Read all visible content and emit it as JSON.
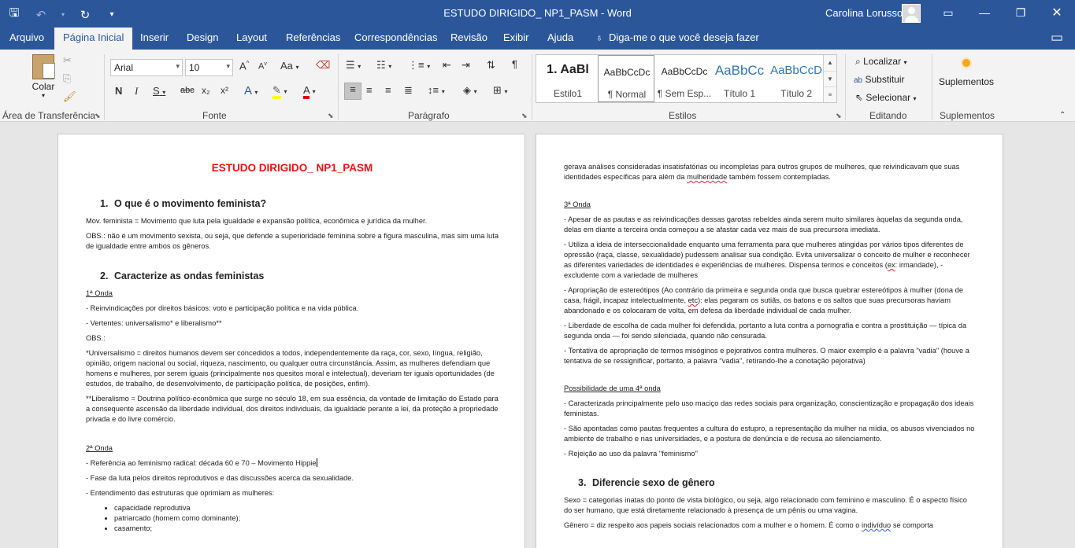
{
  "titlebar": {
    "window_title": "ESTUDO DIRIGIDO_ NP1_PASM  -  Word",
    "user_name": "Carolina Lorusso",
    "icons": {
      "save": "save-icon",
      "undo": "undo-icon",
      "redo": "redo-icon",
      "customize": "customize-qat-icon",
      "ribbon_display": "ribbon-display-options-icon",
      "minimize": "minimize-icon",
      "restore": "restore-icon",
      "close": "close-icon"
    }
  },
  "tabs": [
    "Arquivo",
    "Página Inicial",
    "Inserir",
    "Design",
    "Layout",
    "Referências",
    "Correspondências",
    "Revisão",
    "Exibir",
    "Ajuda"
  ],
  "active_tab": "Página Inicial",
  "tell_me": "Diga-me o que você deseja fazer",
  "ribbon": {
    "clipboard": {
      "paste": "Colar",
      "label": "Área de Transferência"
    },
    "font": {
      "name": "Arial",
      "size": "10",
      "label": "Fonte",
      "buttons": {
        "grow": "A",
        "shrink": "A",
        "case": "Aa",
        "bold": "N",
        "italic": "I",
        "underline": "S",
        "strike": "abc",
        "sub": "x₂",
        "sup": "x²",
        "effects": "A",
        "font_color": "A"
      }
    },
    "paragraph": {
      "label": "Parágrafo"
    },
    "styles": {
      "label": "Estilos",
      "items": [
        {
          "preview": "1. AaBl",
          "name": "Estilo1"
        },
        {
          "preview": "AaBbCcDc",
          "name": "¶ Normal"
        },
        {
          "preview": "AaBbCcDc",
          "name": "¶ Sem Esp..."
        },
        {
          "preview": "AaBbCc",
          "name": "Título 1"
        },
        {
          "preview": "AaBbCcD",
          "name": "Título 2"
        }
      ]
    },
    "editing": {
      "label": "Editando",
      "find": "Localizar",
      "replace": "Substituir",
      "select": "Selecionar"
    },
    "addins": {
      "button": "Suplementos",
      "label": "Suplementos"
    }
  },
  "colors": {
    "accent": "#2b579a",
    "doc_title": "#ee1111",
    "ribbon_bg": "#f3f3f3",
    "canvas": "#e6e6e6"
  },
  "page1": {
    "title": "ESTUDO DIRIGIDO_ NP1_PASM",
    "q1": {
      "num": "1.",
      "text": "O que é o movimento feminista?"
    },
    "p1": "Mov. feminista = Movimento que luta pela igualdade e expansão política, econômica e jurídica da mulher.",
    "p2": "OBS.: não é um movimento sexista, ou seja, que defende a superioridade feminina sobre a figura masculina, mas sim uma luta de igualdade entre ambos os gêneros.",
    "q2": {
      "num": "2.",
      "text": "Caracterize as ondas feministas"
    },
    "onda1": "1ª Onda",
    "p3": "- Reinvindicações por direitos básicos: voto e participação política e na vida pública.",
    "p4": "- Vertentes: universalismo* e liberalismo**",
    "p5": "OBS.:",
    "p6": "*Universalismo = direitos humanos devem ser concedidos a todos, independentemente da raça, cor, sexo, língua, religião, opinião, origem nacional ou social, riqueza, nascimento, ou qualquer outra circunstância. Assim, as mulheres defendiam que homens e mulheres, por serem iguais (principalmente nos quesitos moral e intelectual), deveriam ter iguais oportunidades (de estudos, de trabalho, de desenvolvimento, de participação política, de posições, enfim).",
    "p7": "**Liberalismo = Doutrina político-econômica que surge no século 18, em sua essência, da vontade de limitação do Estado para a consequente ascensão da liberdade individual, dos direitos individuais, da igualdade perante a lei, da proteção à propriedade privada e do livre comércio.",
    "onda2": "2ª Onda",
    "p8": "- Referência ao feminismo radical: década 60 e 70 – Movimento Hippie",
    "p9": "- Fase da luta pelos direitos reprodutivos e das discussões acerca da sexualidade.",
    "p10": "- Entendimento das estruturas que oprimiam as mulheres:",
    "bullets": [
      "capacidade reprodutiva",
      "patriarcado (homem como dominante);",
      "casamento;"
    ]
  },
  "page2": {
    "c1a": "gerava análises consideradas insatisfatórias ou incompletas para outros grupos de mulheres, que reivindicavam que suas identidades específicas para além da ",
    "c1sq": "mulheridade",
    "c1b": " também fossem contempladas.",
    "onda3": "3ª Onda",
    "b1": "- Apesar de as pautas e as reivindicações dessas garotas rebeldes ainda serem muito similares àquelas da segunda onda, delas em diante a terceira onda começou a se afastar cada vez mais de sua precursora imediata.",
    "b2a": "- Utiliza a ideia de interseccionalidade enquanto uma ferramenta para que mulheres atingidas por vários tipos diferentes de opressão (raça, classe, sexualidade) pudessem analisar sua condição. Evita universalizar o conceito de mulher e reconhecer as diferentes variedades de identidades e experiências de mulheres. Dispensa termos e conceitos (",
    "b2sq": "ex",
    "b2b": ": irmandade), -excludente com a variedade de mulheres",
    "b3a": "- Apropriação de estereótipos (Ao contrário da primeira e segunda onda que busca quebrar estereótipos à mulher (dona de casa, frágil, incapaz intelectualmente, ",
    "b3sq": "etc",
    "b3b": "): elas pegaram os sutiãs, os batons e os saltos que suas precursoras haviam abandonado e os colocaram de volta, em defesa da liberdade individual de cada mulher.",
    "b4": "- Liberdade de escolha de cada mulher foi defendida, portanto a luta contra a pornografia e contra a prostituição — típica da segunda onda — foi sendo silenciada, quando não censurada.",
    "b5": "- Tentativa de apropriação de termos misóginos e pejorativos contra mulheres. O maior exemplo é a palavra \"vadia\" (houve a tentativa de se ressignificar, portanto, a palavra \"vadia\", retirando-lhe a conotação pejorativa)",
    "onda4": "Possibilidade de uma 4ª onda",
    "d1": "- Caracterizada principalmente pelo uso maciço das redes sociais para organização, conscientização e propagação dos ideais feministas.",
    "d2": "- São apontadas como pautas frequentes a cultura do estupro, a representação da mulher na mídia, os abusos vivenciados no ambiente de trabalho e nas universidades, e a postura de denúncia e de recusa ao silenciamento.",
    "d3": "- Rejeição ao uso da palavra \"feminismo\"",
    "q3": {
      "num": "3.",
      "text": "Diferencie sexo de gênero"
    },
    "e1": "Sexo = categorias inatas do ponto de vista biológico, ou seja, algo relacionado com feminino e masculino. É o aspecto físico do ser humano, que está diretamente relacionado à presença de um pênis ou uma vagina.",
    "e2a": "Gênero = diz respeito aos papeis sociais relacionados com a mulher e o homem. É como o ",
    "e2sq": "indivíduo",
    "e2b": " se comporta"
  }
}
